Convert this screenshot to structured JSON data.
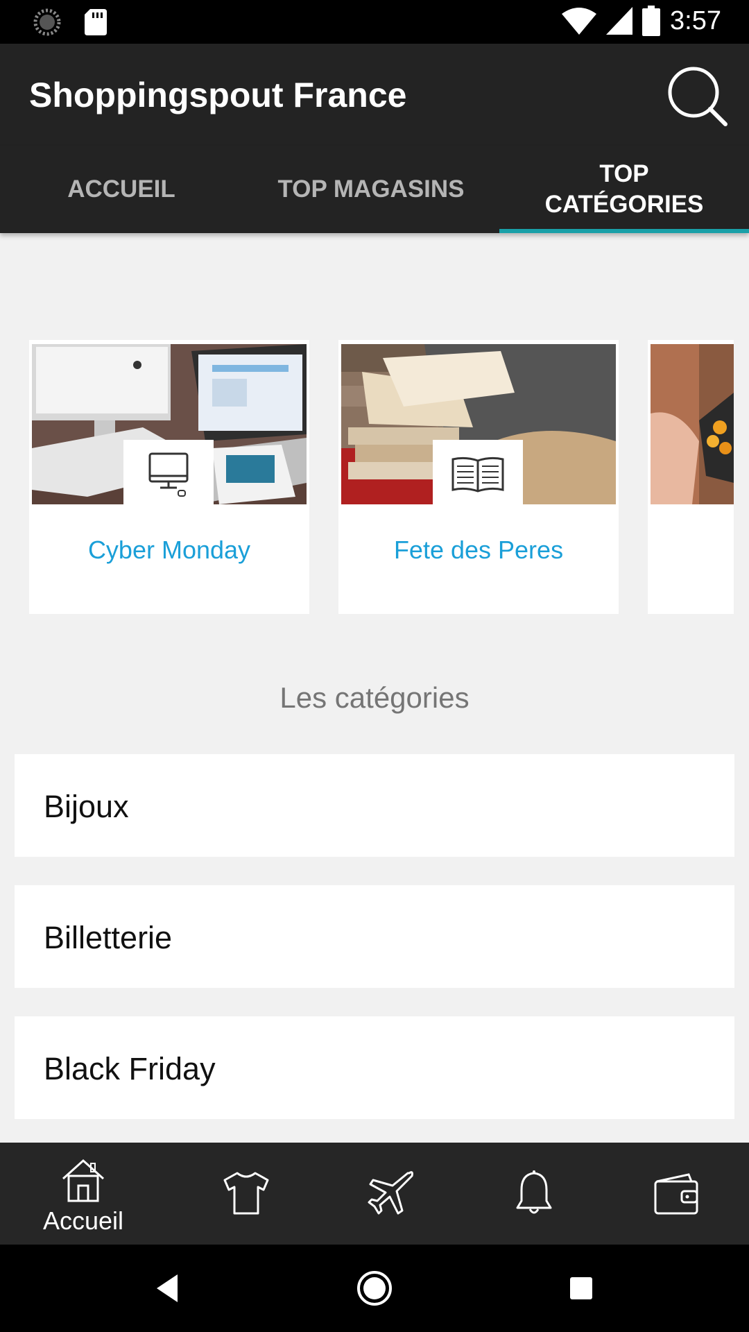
{
  "status_bar": {
    "time": "3:57",
    "icons": [
      "loading-icon",
      "sd-card-icon",
      "wifi-icon",
      "signal-icon",
      "battery-icon"
    ]
  },
  "app_bar": {
    "title": "Shoppingspout France",
    "search_icon": "search-icon"
  },
  "tabs": [
    {
      "label": "ACCUEIL",
      "selected": false
    },
    {
      "label": "TOP MAGASINS",
      "selected": false
    },
    {
      "label": "TOP\nCATÉGORIES",
      "selected": true
    }
  ],
  "carousel": [
    {
      "label": "Cyber Monday",
      "badge_icon": "computer-icon"
    },
    {
      "label": "Fete des Peres",
      "badge_icon": "book-icon"
    },
    {
      "label": "",
      "badge_icon": ""
    }
  ],
  "section_title": "Les catégories",
  "categories": [
    {
      "label": "Bijoux"
    },
    {
      "label": "Billetterie"
    },
    {
      "label": "Black Friday"
    }
  ],
  "bottom_nav": [
    {
      "icon": "home-icon",
      "label": "Accueil"
    },
    {
      "icon": "tshirt-icon",
      "label": ""
    },
    {
      "icon": "plane-icon",
      "label": ""
    },
    {
      "icon": "bell-icon",
      "label": ""
    },
    {
      "icon": "wallet-icon",
      "label": ""
    }
  ],
  "colors": {
    "toolbar": "#232323",
    "accent": "#19a0a8",
    "link": "#1a9fd8",
    "background": "#f1f1f1"
  }
}
